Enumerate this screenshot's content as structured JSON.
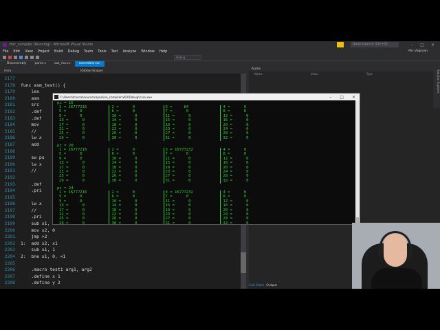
{
  "window": {
    "title": "zrsc_compiler (Running) - Microsoft Visual Studio",
    "quick_launch": "Quick Launch (Ctrl+Q)",
    "user": "Per Vognsen"
  },
  "menu": [
    "File",
    "Edit",
    "View",
    "Project",
    "Build",
    "Debug",
    "Team",
    "Tools",
    "Test",
    "Analyze",
    "Window",
    "Help"
  ],
  "toolbar": {
    "config": "Debug"
  },
  "tabs": [
    {
      "label": "Disassembly",
      "active": false
    },
    {
      "label": "parse.c",
      "active": false
    },
    {
      "label": "out_riscv.c",
      "active": false
    },
    {
      "label": "assembler.ion",
      "active": true
    }
  ],
  "editor": {
    "project": "riscv",
    "scope": "(Global Scope)",
    "lines": [
      {
        "n": "2177",
        "t": ""
      },
      {
        "n": "2178",
        "t": "func asm_test() {"
      },
      {
        "n": "2179",
        "t": "    lex"
      },
      {
        "n": "2180",
        "t": "    asm"
      },
      {
        "n": "2181",
        "t": "    src"
      },
      {
        "n": "2182",
        "t": "    .def"
      },
      {
        "n": "2183",
        "t": "    .def"
      },
      {
        "n": "2184",
        "t": "    mov"
      },
      {
        "n": "2185",
        "t": "    //"
      },
      {
        "n": "2186",
        "t": "    lw x"
      },
      {
        "n": "2187",
        "t": "    add"
      },
      {
        "n": "2188",
        "t": ""
      },
      {
        "n": "2189",
        "t": "    sw pu"
      },
      {
        "n": "2190",
        "t": "    lw x"
      },
      {
        "n": "2191",
        "t": "    //"
      },
      {
        "n": "2192",
        "t": ""
      },
      {
        "n": "2193",
        "t": "    .def"
      },
      {
        "n": "2194",
        "t": "    .pri"
      },
      {
        "n": "2195",
        "t": ""
      },
      {
        "n": "2196",
        "t": "    lw x"
      },
      {
        "n": "2197",
        "t": "    //"
      },
      {
        "n": "2198",
        "t": "    .pri"
      },
      {
        "n": "2199",
        "t": "    sub x1, 48"
      },
      {
        "n": "2200",
        "t": "    mov x2, 0"
      },
      {
        "n": "2201",
        "t": "    jmp >2"
      },
      {
        "n": "2202",
        "t": "1:  add x2, x1"
      },
      {
        "n": "2203",
        "t": "    sub x1, 1"
      },
      {
        "n": "2204",
        "t": "2:  bne x1, 0, <1"
      },
      {
        "n": "2205",
        "t": ""
      },
      {
        "n": "2206",
        "t": "    .macro test1 arg1, arg2"
      },
      {
        "n": "2207",
        "t": "    .define x 1"
      },
      {
        "n": "2208",
        "t": "    .define y 2"
      }
    ]
  },
  "autos": {
    "title": "Autos",
    "cols": [
      "Name",
      "Value",
      "Type"
    ]
  },
  "bottom_tabs": [
    "Call Stack",
    "Output"
  ],
  "solution_explorer": "Solution Explorer",
  "console": {
    "path": "C:\\Users\\lcavcal\\source\\repos\\ion_compiler\\x64\\Debug\\riscv.exe",
    "headers": [
      "pc = 16",
      "pc = 20",
      "pc = 24"
    ],
    "blocks": [
      {
        "c1": [
          "1 = 16777216",
          "5 =      0",
          "9 =      0",
          "13 =      0",
          "17 =      0",
          "21 =      0",
          "25 =      0",
          "29 =      0"
        ],
        "c2": [
          "2 =      0",
          "6 =      0",
          "10 =      0",
          "14 =      0",
          "18 =      0",
          "22 =      0",
          "26 =      0",
          "30 =      0"
        ],
        "c3": [
          "3 =     84",
          "7 =      0",
          "11 =      0",
          "15 =      0",
          "19 =      0",
          "23 =      0",
          "27 =      0",
          "31 =      0"
        ],
        "c4": [
          "4 =      0",
          "8 =      0",
          "12 =      0",
          "16 =      0",
          "20 =      0",
          "24 =      0",
          "28 =      0",
          "32 =      0"
        ]
      },
      {
        "c1": [
          "1 = 16777216",
          "5 =      0",
          "9 =      0",
          "13 =      0",
          "17 =      0",
          "21 =      0",
          "25 =      0",
          "29 =      0"
        ],
        "c2": [
          "2 =      0",
          "6 =      0",
          "10 =      0",
          "14 =      0",
          "18 =      0",
          "22 =      0",
          "26 =      0",
          "30 =      0"
        ],
        "c3": [
          "3 = 16777232",
          "7 =      0",
          "11 =      0",
          "15 =      0",
          "19 =      0",
          "23 =      0",
          "27 =      0",
          "31 =      0"
        ],
        "c4": [
          "4 =      0",
          "8 =      0",
          "12 =      0",
          "16 =      0",
          "20 =      0",
          "24 =      0",
          "28 =      0",
          "32 =      0"
        ]
      },
      {
        "c1": [
          "1 = 16777216",
          "5 =      0",
          "9 =      0",
          "13 =      0",
          "17 =      0",
          "21 =      0",
          "25 =      0",
          "29 =      0"
        ],
        "c2": [
          "2 =      0",
          "6 =      0",
          "10 =      0",
          "14 =      0",
          "18 =      0",
          "22 =      0",
          "26 =      0",
          "30 =      0"
        ],
        "c3": [
          "3 = 16777232",
          "7 =      0",
          "11 =      0",
          "15 =      0",
          "19 =      0",
          "23 =      0",
          "27 =      0",
          "31 =      0"
        ],
        "c4": [
          "4 =      0",
          "8 =      0",
          "12 =      0",
          "16 =      0",
          "20 =      0",
          "24 =      0",
          "28 =      0",
          "32 =      0"
        ]
      }
    ]
  }
}
